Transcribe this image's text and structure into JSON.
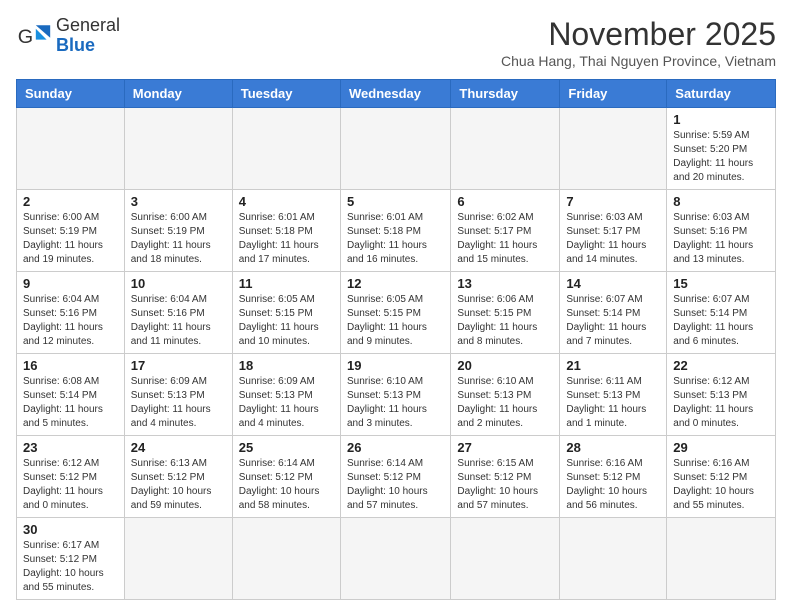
{
  "header": {
    "logo_general": "General",
    "logo_blue": "Blue",
    "month_title": "November 2025",
    "location": "Chua Hang, Thai Nguyen Province, Vietnam"
  },
  "weekdays": [
    "Sunday",
    "Monday",
    "Tuesday",
    "Wednesday",
    "Thursday",
    "Friday",
    "Saturday"
  ],
  "weeks": [
    [
      {
        "day": "",
        "info": ""
      },
      {
        "day": "",
        "info": ""
      },
      {
        "day": "",
        "info": ""
      },
      {
        "day": "",
        "info": ""
      },
      {
        "day": "",
        "info": ""
      },
      {
        "day": "",
        "info": ""
      },
      {
        "day": "1",
        "info": "Sunrise: 5:59 AM\nSunset: 5:20 PM\nDaylight: 11 hours\nand 20 minutes."
      }
    ],
    [
      {
        "day": "2",
        "info": "Sunrise: 6:00 AM\nSunset: 5:19 PM\nDaylight: 11 hours\nand 19 minutes."
      },
      {
        "day": "3",
        "info": "Sunrise: 6:00 AM\nSunset: 5:19 PM\nDaylight: 11 hours\nand 18 minutes."
      },
      {
        "day": "4",
        "info": "Sunrise: 6:01 AM\nSunset: 5:18 PM\nDaylight: 11 hours\nand 17 minutes."
      },
      {
        "day": "5",
        "info": "Sunrise: 6:01 AM\nSunset: 5:18 PM\nDaylight: 11 hours\nand 16 minutes."
      },
      {
        "day": "6",
        "info": "Sunrise: 6:02 AM\nSunset: 5:17 PM\nDaylight: 11 hours\nand 15 minutes."
      },
      {
        "day": "7",
        "info": "Sunrise: 6:03 AM\nSunset: 5:17 PM\nDaylight: 11 hours\nand 14 minutes."
      },
      {
        "day": "8",
        "info": "Sunrise: 6:03 AM\nSunset: 5:16 PM\nDaylight: 11 hours\nand 13 minutes."
      }
    ],
    [
      {
        "day": "9",
        "info": "Sunrise: 6:04 AM\nSunset: 5:16 PM\nDaylight: 11 hours\nand 12 minutes."
      },
      {
        "day": "10",
        "info": "Sunrise: 6:04 AM\nSunset: 5:16 PM\nDaylight: 11 hours\nand 11 minutes."
      },
      {
        "day": "11",
        "info": "Sunrise: 6:05 AM\nSunset: 5:15 PM\nDaylight: 11 hours\nand 10 minutes."
      },
      {
        "day": "12",
        "info": "Sunrise: 6:05 AM\nSunset: 5:15 PM\nDaylight: 11 hours\nand 9 minutes."
      },
      {
        "day": "13",
        "info": "Sunrise: 6:06 AM\nSunset: 5:15 PM\nDaylight: 11 hours\nand 8 minutes."
      },
      {
        "day": "14",
        "info": "Sunrise: 6:07 AM\nSunset: 5:14 PM\nDaylight: 11 hours\nand 7 minutes."
      },
      {
        "day": "15",
        "info": "Sunrise: 6:07 AM\nSunset: 5:14 PM\nDaylight: 11 hours\nand 6 minutes."
      }
    ],
    [
      {
        "day": "16",
        "info": "Sunrise: 6:08 AM\nSunset: 5:14 PM\nDaylight: 11 hours\nand 5 minutes."
      },
      {
        "day": "17",
        "info": "Sunrise: 6:09 AM\nSunset: 5:13 PM\nDaylight: 11 hours\nand 4 minutes."
      },
      {
        "day": "18",
        "info": "Sunrise: 6:09 AM\nSunset: 5:13 PM\nDaylight: 11 hours\nand 4 minutes."
      },
      {
        "day": "19",
        "info": "Sunrise: 6:10 AM\nSunset: 5:13 PM\nDaylight: 11 hours\nand 3 minutes."
      },
      {
        "day": "20",
        "info": "Sunrise: 6:10 AM\nSunset: 5:13 PM\nDaylight: 11 hours\nand 2 minutes."
      },
      {
        "day": "21",
        "info": "Sunrise: 6:11 AM\nSunset: 5:13 PM\nDaylight: 11 hours\nand 1 minute."
      },
      {
        "day": "22",
        "info": "Sunrise: 6:12 AM\nSunset: 5:13 PM\nDaylight: 11 hours\nand 0 minutes."
      }
    ],
    [
      {
        "day": "23",
        "info": "Sunrise: 6:12 AM\nSunset: 5:12 PM\nDaylight: 11 hours\nand 0 minutes."
      },
      {
        "day": "24",
        "info": "Sunrise: 6:13 AM\nSunset: 5:12 PM\nDaylight: 10 hours\nand 59 minutes."
      },
      {
        "day": "25",
        "info": "Sunrise: 6:14 AM\nSunset: 5:12 PM\nDaylight: 10 hours\nand 58 minutes."
      },
      {
        "day": "26",
        "info": "Sunrise: 6:14 AM\nSunset: 5:12 PM\nDaylight: 10 hours\nand 57 minutes."
      },
      {
        "day": "27",
        "info": "Sunrise: 6:15 AM\nSunset: 5:12 PM\nDaylight: 10 hours\nand 57 minutes."
      },
      {
        "day": "28",
        "info": "Sunrise: 6:16 AM\nSunset: 5:12 PM\nDaylight: 10 hours\nand 56 minutes."
      },
      {
        "day": "29",
        "info": "Sunrise: 6:16 AM\nSunset: 5:12 PM\nDaylight: 10 hours\nand 55 minutes."
      }
    ],
    [
      {
        "day": "30",
        "info": "Sunrise: 6:17 AM\nSunset: 5:12 PM\nDaylight: 10 hours\nand 55 minutes."
      },
      {
        "day": "",
        "info": ""
      },
      {
        "day": "",
        "info": ""
      },
      {
        "day": "",
        "info": ""
      },
      {
        "day": "",
        "info": ""
      },
      {
        "day": "",
        "info": ""
      },
      {
        "day": "",
        "info": ""
      }
    ]
  ]
}
